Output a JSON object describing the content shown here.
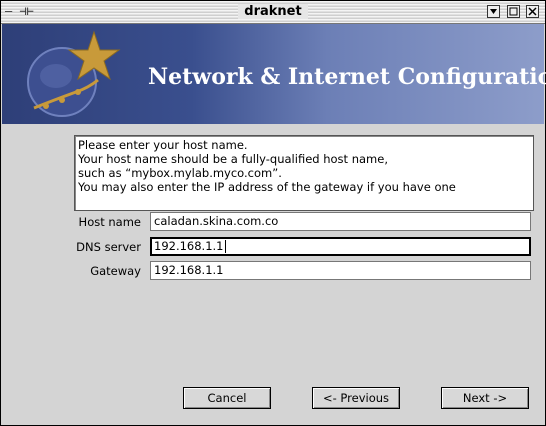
{
  "window": {
    "title": "draknet",
    "left_glyphs": "— ⊣⊢"
  },
  "banner": {
    "heading": "Network & Internet Configuration"
  },
  "message": {
    "lines": [
      "Please enter your host name.",
      "Your host name should be a fully-qualified host name,",
      "such as “mybox.mylab.myco.com”.",
      "You may also enter the IP address of the gateway if you have one"
    ]
  },
  "form": {
    "host_label": "Host name",
    "host_value": "caladan.skina.com.co",
    "dns_label": "DNS server",
    "dns_value": "192.168.1.1",
    "gateway_label": "Gateway",
    "gateway_value": "192.168.1.1"
  },
  "buttons": {
    "cancel": "Cancel",
    "previous": "<- Previous",
    "next": "Next ->"
  },
  "colors": {
    "banner_dark": "#2e3f78",
    "banner_light": "#8d9dca",
    "star": "#c89a3a"
  }
}
